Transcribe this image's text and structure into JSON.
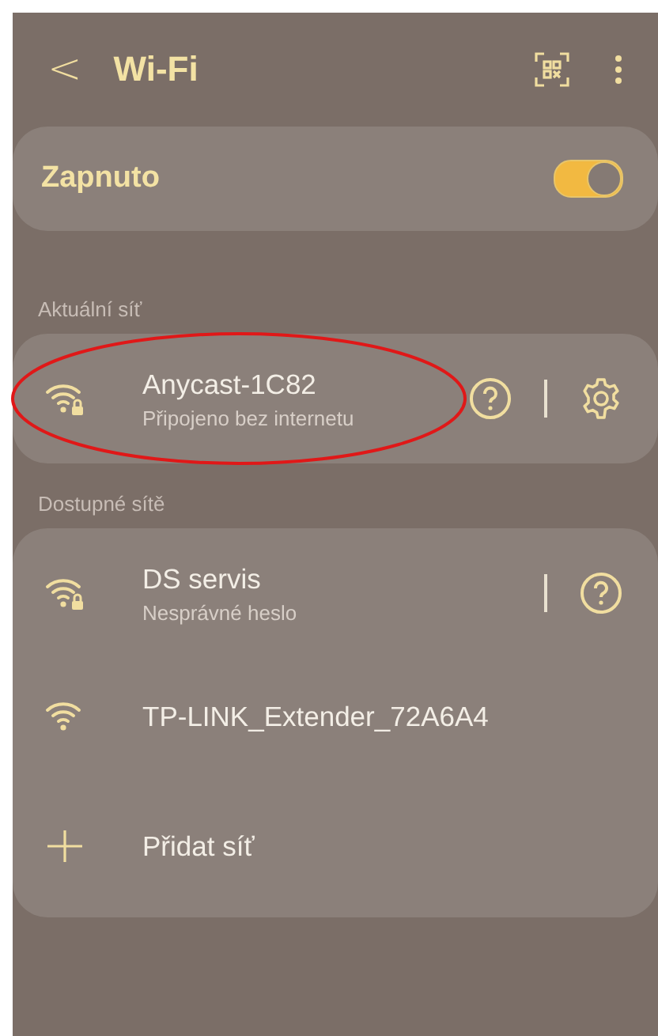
{
  "header": {
    "back": "<",
    "title": "Wi-Fi"
  },
  "master_switch": {
    "label": "Zapnuto",
    "on": true
  },
  "current_section": {
    "title": "Aktuální síť",
    "networks": [
      {
        "kind": "network",
        "name": "Anycast-1C82",
        "status": "Připojeno bez internetu",
        "secured": true,
        "help": true,
        "settings": true,
        "circled": true
      }
    ]
  },
  "available_section": {
    "title": "Dostupné sítě",
    "networks": [
      {
        "kind": "network",
        "name": "DS servis",
        "status": "Nesprávné heslo",
        "secured": true,
        "help": true,
        "settings": false,
        "circled": false
      },
      {
        "kind": "network",
        "name": "TP-LINK_Extender_72A6A4",
        "secured": false,
        "help": false,
        "settings": false,
        "circled": false
      },
      {
        "kind": "add",
        "name": "Přidat síť"
      }
    ]
  }
}
